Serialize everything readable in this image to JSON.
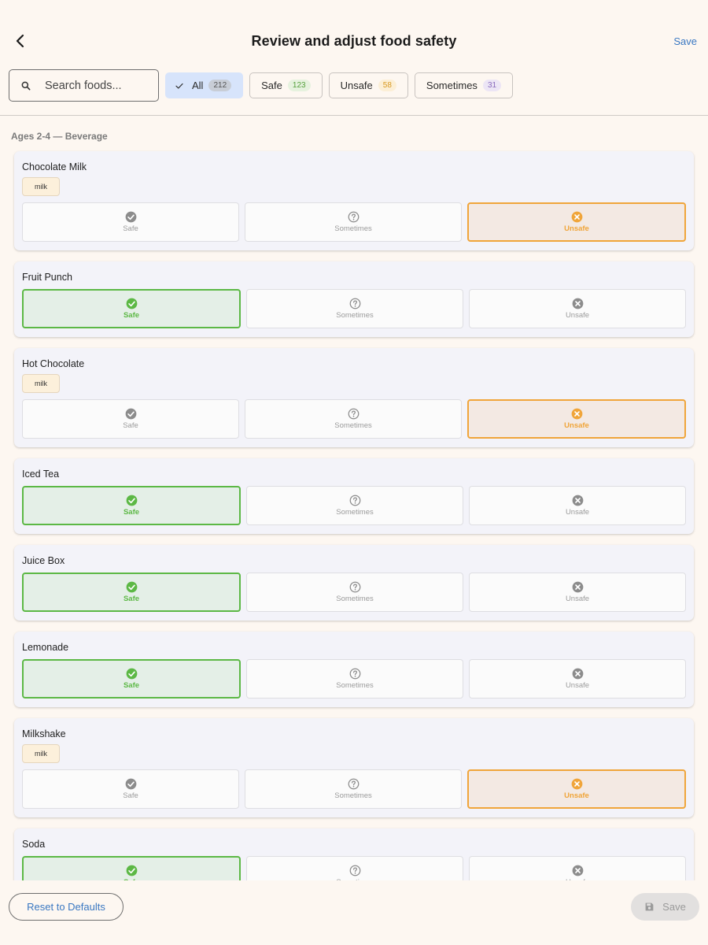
{
  "header": {
    "title": "Review and adjust food safety",
    "save_label": "Save",
    "back_icon": "chevron-left-icon"
  },
  "search": {
    "placeholder": "Search foods..."
  },
  "filters": [
    {
      "label": "All",
      "count": "212",
      "active": true
    },
    {
      "label": "Safe",
      "count": "123",
      "active": false
    },
    {
      "label": "Unsafe",
      "count": "58",
      "active": false
    },
    {
      "label": "Sometimes",
      "count": "31",
      "active": false
    }
  ],
  "section": {
    "title": "Ages 2-4 — Beverage"
  },
  "option_labels": {
    "safe": "Safe",
    "sometimes": "Sometimes",
    "unsafe": "Unsafe"
  },
  "foods": [
    {
      "name": "Chocolate Milk",
      "tag": "milk",
      "selected": "unsafe"
    },
    {
      "name": "Fruit Punch",
      "tag": "",
      "selected": "safe"
    },
    {
      "name": "Hot Chocolate",
      "tag": "milk",
      "selected": "unsafe"
    },
    {
      "name": "Iced Tea",
      "tag": "",
      "selected": "safe"
    },
    {
      "name": "Juice Box",
      "tag": "",
      "selected": "safe"
    },
    {
      "name": "Lemonade",
      "tag": "",
      "selected": "safe"
    },
    {
      "name": "Milkshake",
      "tag": "milk",
      "selected": "unsafe"
    },
    {
      "name": "Soda",
      "tag": "",
      "selected": "safe"
    }
  ],
  "bottom": {
    "reset_label": "Reset to Defaults",
    "save_label": "Save",
    "save_enabled": false
  },
  "colors": {
    "safe": "#5cb845",
    "unsafe": "#f0a53a",
    "accent": "#3a78c2",
    "neutral_icon": "#8c8c8c"
  }
}
